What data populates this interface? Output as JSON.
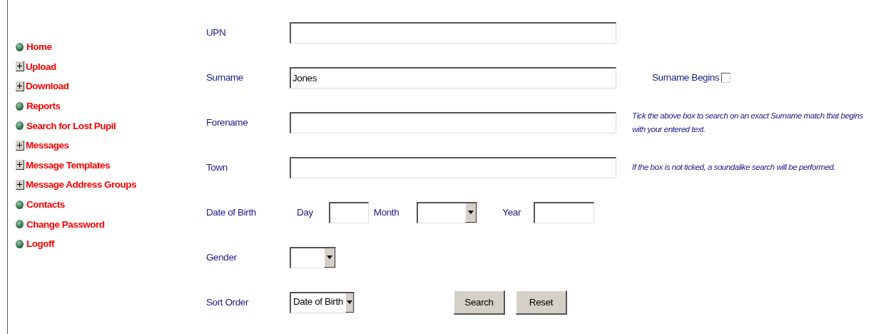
{
  "sidebar": {
    "items": [
      {
        "label": "Home",
        "kind": "bullet"
      },
      {
        "label": "Upload",
        "kind": "expand"
      },
      {
        "label": "Download",
        "kind": "expand"
      },
      {
        "label": "Reports",
        "kind": "bullet"
      },
      {
        "label": "Search for Lost Pupil",
        "kind": "bullet"
      },
      {
        "label": "Messages",
        "kind": "expand"
      },
      {
        "label": "Message Templates",
        "kind": "expand"
      },
      {
        "label": "Message Address Groups",
        "kind": "expand"
      },
      {
        "label": "Contacts",
        "kind": "bullet"
      },
      {
        "label": "Change Password",
        "kind": "bullet"
      },
      {
        "label": "Logoff",
        "kind": "bullet"
      }
    ]
  },
  "fields": [
    {
      "label": "UPN",
      "kind": "text"
    },
    {
      "label": "Surname",
      "kind": "text",
      "value": "Jones"
    },
    {
      "label": "Forename",
      "kind": "text"
    },
    {
      "label": "Town",
      "kind": "text"
    },
    {
      "label": "Date of Birth",
      "kind": "date",
      "parts": [
        {
          "label": "Day",
          "kind": "text"
        },
        {
          "label": "Month",
          "kind": "select"
        },
        {
          "label": "Year",
          "kind": "text"
        }
      ]
    },
    {
      "label": "Gender",
      "kind": "select"
    },
    {
      "label": "Sort Order",
      "kind": "select",
      "value": "Date of Birth"
    }
  ],
  "surname_begins": {
    "label": "Surname Begins",
    "checked": false
  },
  "notes": [
    "Tick the above box to search on an exact Surname match that begins with your entered text.",
    "If the box is not ticked, a soundalike search will be performed."
  ],
  "buttons": [
    "Search",
    "Reset"
  ]
}
